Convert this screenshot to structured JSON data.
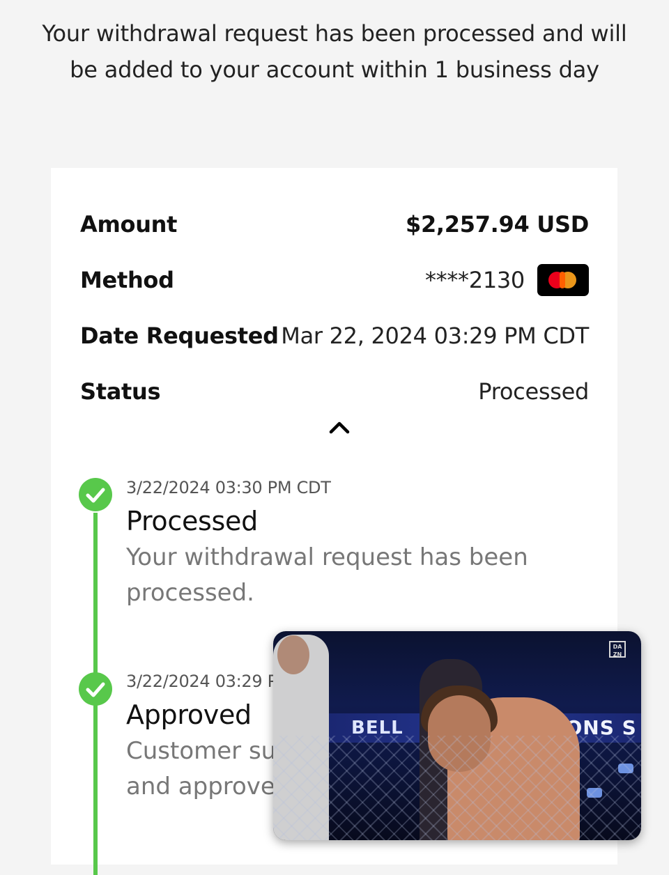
{
  "header": {
    "message_line1": "Your withdrawal request has been processed and will",
    "message_line2": "be added to your account within 1 business day"
  },
  "details": {
    "amount_label": "Amount",
    "amount_value": "$2,257.94 USD",
    "method_label": "Method",
    "method_value": "****2130",
    "method_icon": "mastercard-icon",
    "date_label": "Date Requested",
    "date_value": "Mar 22, 2024 03:29 PM CDT",
    "status_label": "Status",
    "status_value": "Processed"
  },
  "timeline": [
    {
      "time": "3/22/2024 03:30 PM CDT",
      "title": "Processed",
      "desc_line1": "Your withdrawal request has been",
      "desc_line2": "processed."
    },
    {
      "time": "3/22/2024 03:29 P",
      "title": "Approved",
      "desc_line1": "Customer su",
      "desc_line2": "and approve"
    }
  ],
  "video": {
    "banner_left": "BELL",
    "banner_right": "AMPIONS S",
    "logo_line1": "DA",
    "logo_line2": "ZN"
  },
  "colors": {
    "status_green": "#58c84b",
    "card_bg": "#ffffff",
    "page_bg": "#f4f4f4"
  }
}
